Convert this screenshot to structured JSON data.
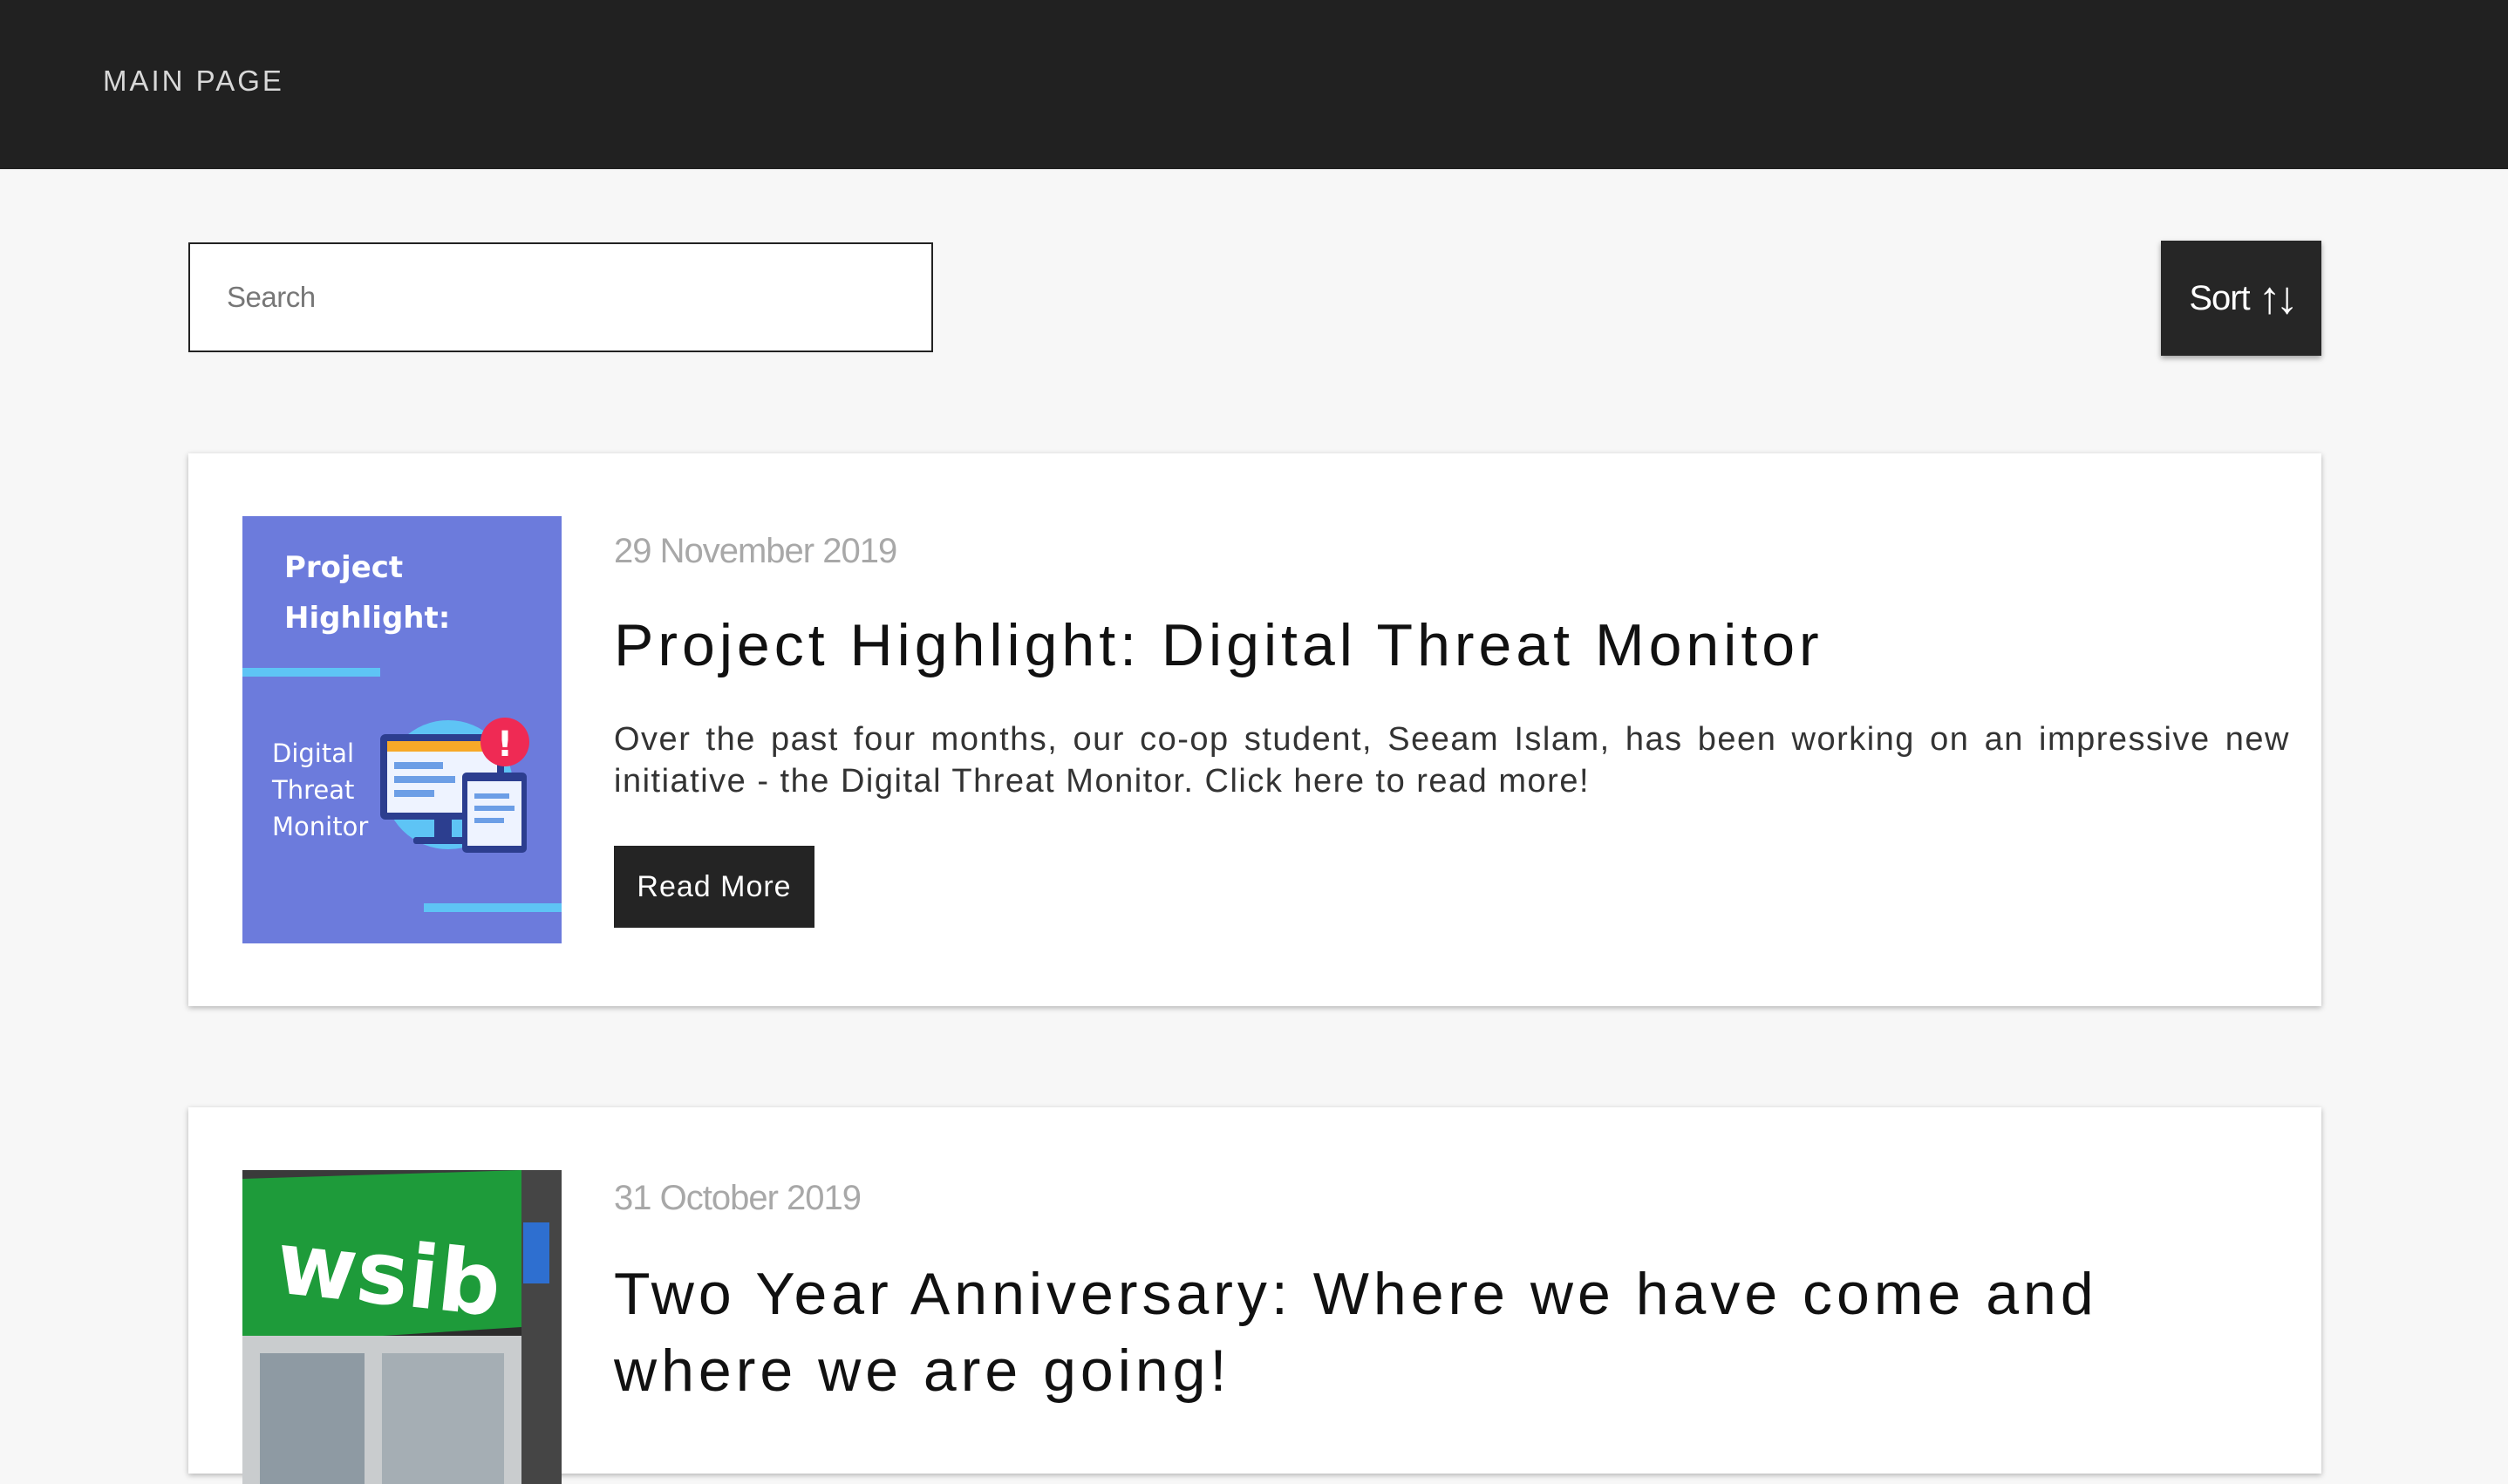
{
  "nav": {
    "main_page": "MAIN PAGE"
  },
  "search": {
    "placeholder": "Search",
    "value": ""
  },
  "sort": {
    "label": "Sort",
    "icon": "sort-arrows-icon"
  },
  "posts": [
    {
      "date": "29 November 2019",
      "title": "Project Highlight: Digital Threat Monitor",
      "excerpt": "Over the past four months, our co-op student, Seeam Islam, has been working on an impressive new initiative - the Digital Threat Monitor. Click here to read more!",
      "button": "Read More",
      "thumb": {
        "heading_1": "Project",
        "heading_2": "Highlight:",
        "sub_1": "Digital",
        "sub_2": "Threat",
        "sub_3": "Monitor",
        "bg_color": "#6c7bdc",
        "accent_color": "#5ec4f5",
        "alert_color": "#ef2a54"
      }
    },
    {
      "date": "31 October 2019",
      "title": "Two Year Anniversary: Where we have come and where we are going!",
      "thumb": {
        "sign_text": "wsib",
        "bg_color": "#1e9b3a"
      }
    }
  ],
  "colors": {
    "header_bg": "#212121",
    "page_bg": "#f7f7f7",
    "button_bg": "#242424"
  }
}
